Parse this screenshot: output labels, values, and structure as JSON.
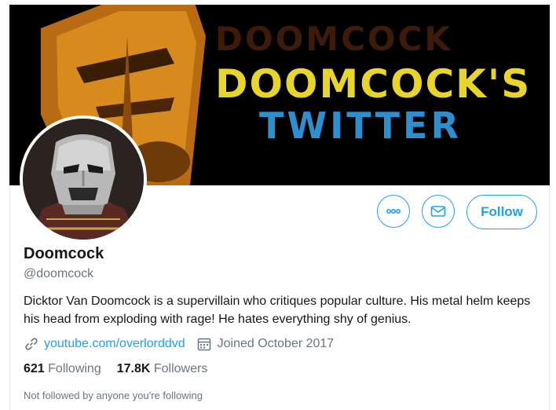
{
  "banner": {
    "line1": "DOOMCOCK'S",
    "line2": "TWITTER",
    "ghost": "DOOMCOCK"
  },
  "profile": {
    "name": "Doomcock",
    "handle": "@doomcock",
    "bio": "Dicktor Van Doomcock is a supervillain who critiques popular culture. His metal helm keeps his head from exploding with rage! He hates everything shy of genius.",
    "website": "youtube.com/overlorddvd",
    "joined": "Joined October 2017"
  },
  "actions": {
    "follow_label": "Follow"
  },
  "stats": {
    "following_count": "621",
    "following_label": "Following",
    "followers_count": "17.8K",
    "followers_label": "Followers"
  },
  "social_context": "Not followed by anyone you're following",
  "colors": {
    "accent": "#1da1f2",
    "banner_yellow": "#e8d52a",
    "banner_blue": "#2b8fd0"
  }
}
